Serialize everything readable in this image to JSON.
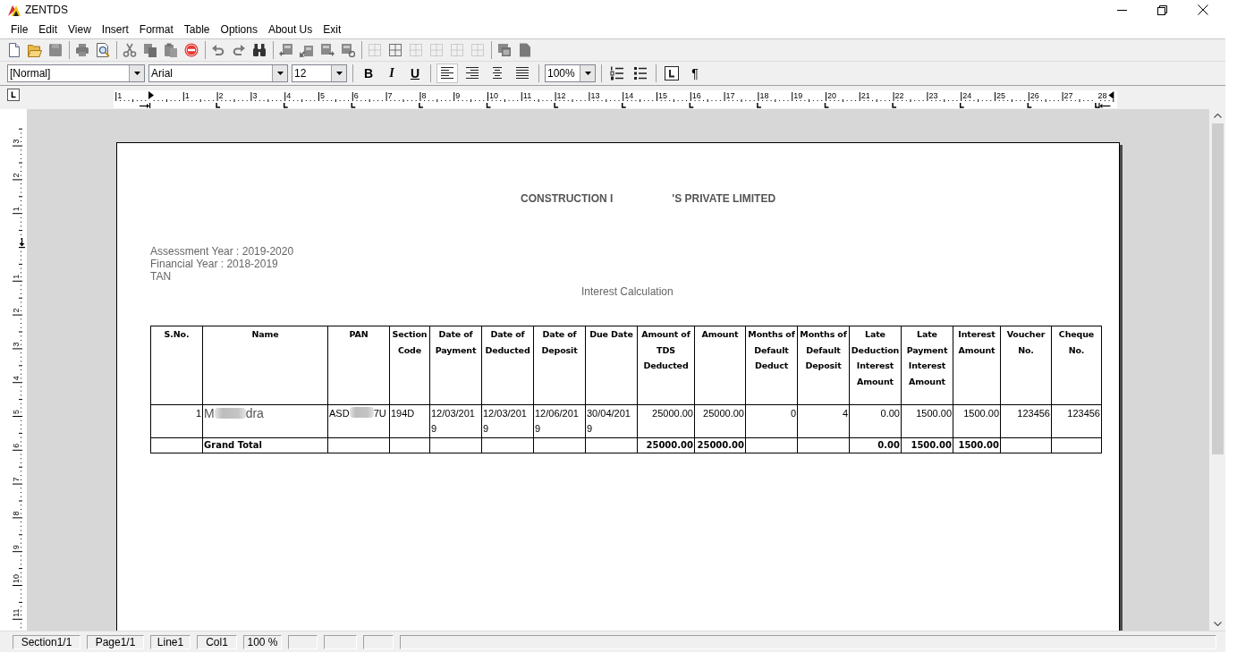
{
  "window": {
    "title": "ZENTDS"
  },
  "menu": [
    "File",
    "Edit",
    "View",
    "Insert",
    "Format",
    "Table",
    "Options",
    "About Us",
    "Exit"
  ],
  "format_bar": {
    "style": "[Normal]",
    "font": "Arial",
    "size": "12",
    "text_styles": [
      {
        "label": "B",
        "kind": "bold"
      },
      {
        "label": "I",
        "kind": "italic"
      },
      {
        "label": "U",
        "kind": "underline"
      }
    ],
    "alignment": [
      {
        "kind": "left",
        "selected": true
      },
      {
        "kind": "right",
        "selected": false
      },
      {
        "kind": "center",
        "selected": false
      },
      {
        "kind": "justify",
        "selected": false
      }
    ],
    "zoom": "100%",
    "pilcrow": "¶"
  },
  "ruler": {
    "labels": [
      "1",
      "1",
      "2",
      "3",
      "4",
      "5",
      "6",
      "7",
      "8",
      "9",
      "10",
      "11",
      "12",
      "13",
      "14",
      "15",
      "16",
      "17",
      "18",
      "19",
      "20",
      "21",
      "22",
      "23",
      "24",
      "25",
      "26",
      "27",
      "28"
    ]
  },
  "vertical_ruler": {
    "labels": [
      "3",
      "2",
      "1",
      "1",
      "2",
      "3",
      "4",
      "5",
      "6",
      "7",
      "8",
      "9",
      "10",
      "11"
    ]
  },
  "document": {
    "company_name_parts": [
      "CONSTRUCTION I",
      "'S PRIVATE LIMITED"
    ],
    "info_lines": [
      "Assessment Year : 2019-2020",
      "Financial Year : 2018-2019",
      "TAN"
    ],
    "heading": "Interest Calculation",
    "table": {
      "columns": [
        {
          "label": "S.No.",
          "kind": "number"
        },
        {
          "label": "Name",
          "kind": "name"
        },
        {
          "label": "PAN",
          "kind": "text"
        },
        {
          "label": "Section Code",
          "kind": "text"
        },
        {
          "label": "Date of Payment",
          "kind": "text"
        },
        {
          "label": "Date of Deducted",
          "kind": "text"
        },
        {
          "label": "Date of Deposit",
          "kind": "text"
        },
        {
          "label": "Due Date",
          "kind": "text"
        },
        {
          "label": "Amount of TDS Deducted",
          "kind": "number"
        },
        {
          "label": "Amount",
          "kind": "number"
        },
        {
          "label": "Months of Default Deduct",
          "kind": "number"
        },
        {
          "label": "Months of Default Deposit",
          "kind": "number"
        },
        {
          "label": "Late Deduction Interest Amount",
          "kind": "number"
        },
        {
          "label": "Late Payment Interest Amount",
          "kind": "number"
        },
        {
          "label": "Interest Amount",
          "kind": "number"
        },
        {
          "label": "Voucher No.",
          "kind": "number"
        },
        {
          "label": "Cheque No.",
          "kind": "number"
        }
      ],
      "rows": [
        {
          "kind": "entry",
          "cells": [
            "1",
            {
              "start": "M",
              "end": "dra"
            },
            {
              "start": "ASD",
              "end": "7U"
            },
            "194D",
            "12/03/2019",
            "12/03/2019",
            "12/06/2019",
            "30/04/2019",
            "25000.00",
            "25000.00",
            "0",
            "4",
            "0.00",
            "1500.00",
            "1500.00",
            "123456",
            "123456"
          ]
        },
        {
          "kind": "total",
          "cells": [
            null,
            "Grand Total",
            null,
            null,
            null,
            null,
            null,
            null,
            "25000.00",
            "25000.00",
            null,
            null,
            "0.00",
            "1500.00",
            "1500.00",
            null,
            null
          ]
        }
      ]
    }
  },
  "status_bar": {
    "panels": [
      "Section1/1",
      "Page1/1",
      "Line1",
      "Col1",
      "100 %"
    ]
  }
}
